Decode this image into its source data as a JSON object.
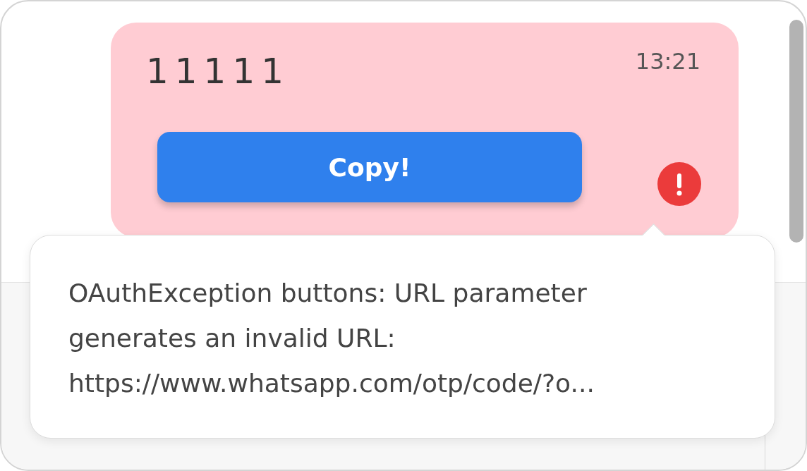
{
  "message": {
    "text": "11111",
    "time": "13:21",
    "failed": true,
    "button": "Copy!"
  },
  "tooltip": {
    "text": "OAuthException buttons: URL parameter generates an invalid URL: https://www.whatsapp.com/otp/code/?o..."
  }
}
